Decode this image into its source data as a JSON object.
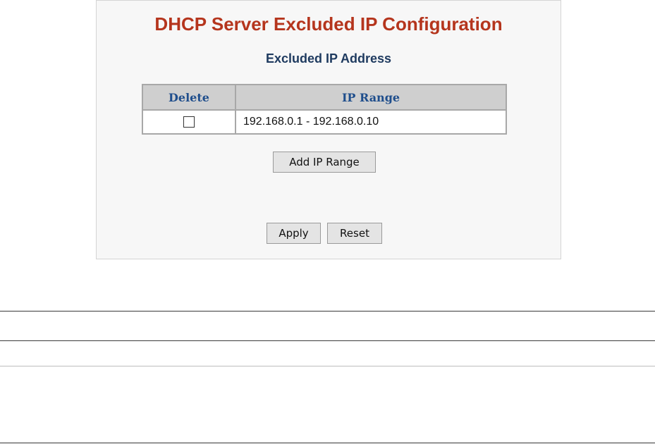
{
  "page": {
    "title": "DHCP Server Excluded IP Configuration",
    "section_title": "Excluded IP Address"
  },
  "table": {
    "headers": {
      "delete": "Delete",
      "ip_range": "IP Range"
    },
    "rows": [
      {
        "delete_checked": false,
        "ip_range": "192.168.0.1 - 192.168.0.10"
      }
    ]
  },
  "buttons": {
    "add_ip_range": "Add IP Range",
    "apply": "Apply",
    "reset": "Reset"
  },
  "colors": {
    "title": "#b5351d",
    "section_title": "#1e3a5f",
    "table_header_text": "#1f4e8c",
    "table_header_bg": "#cfcfcf",
    "panel_bg": "#f7f7f7"
  }
}
